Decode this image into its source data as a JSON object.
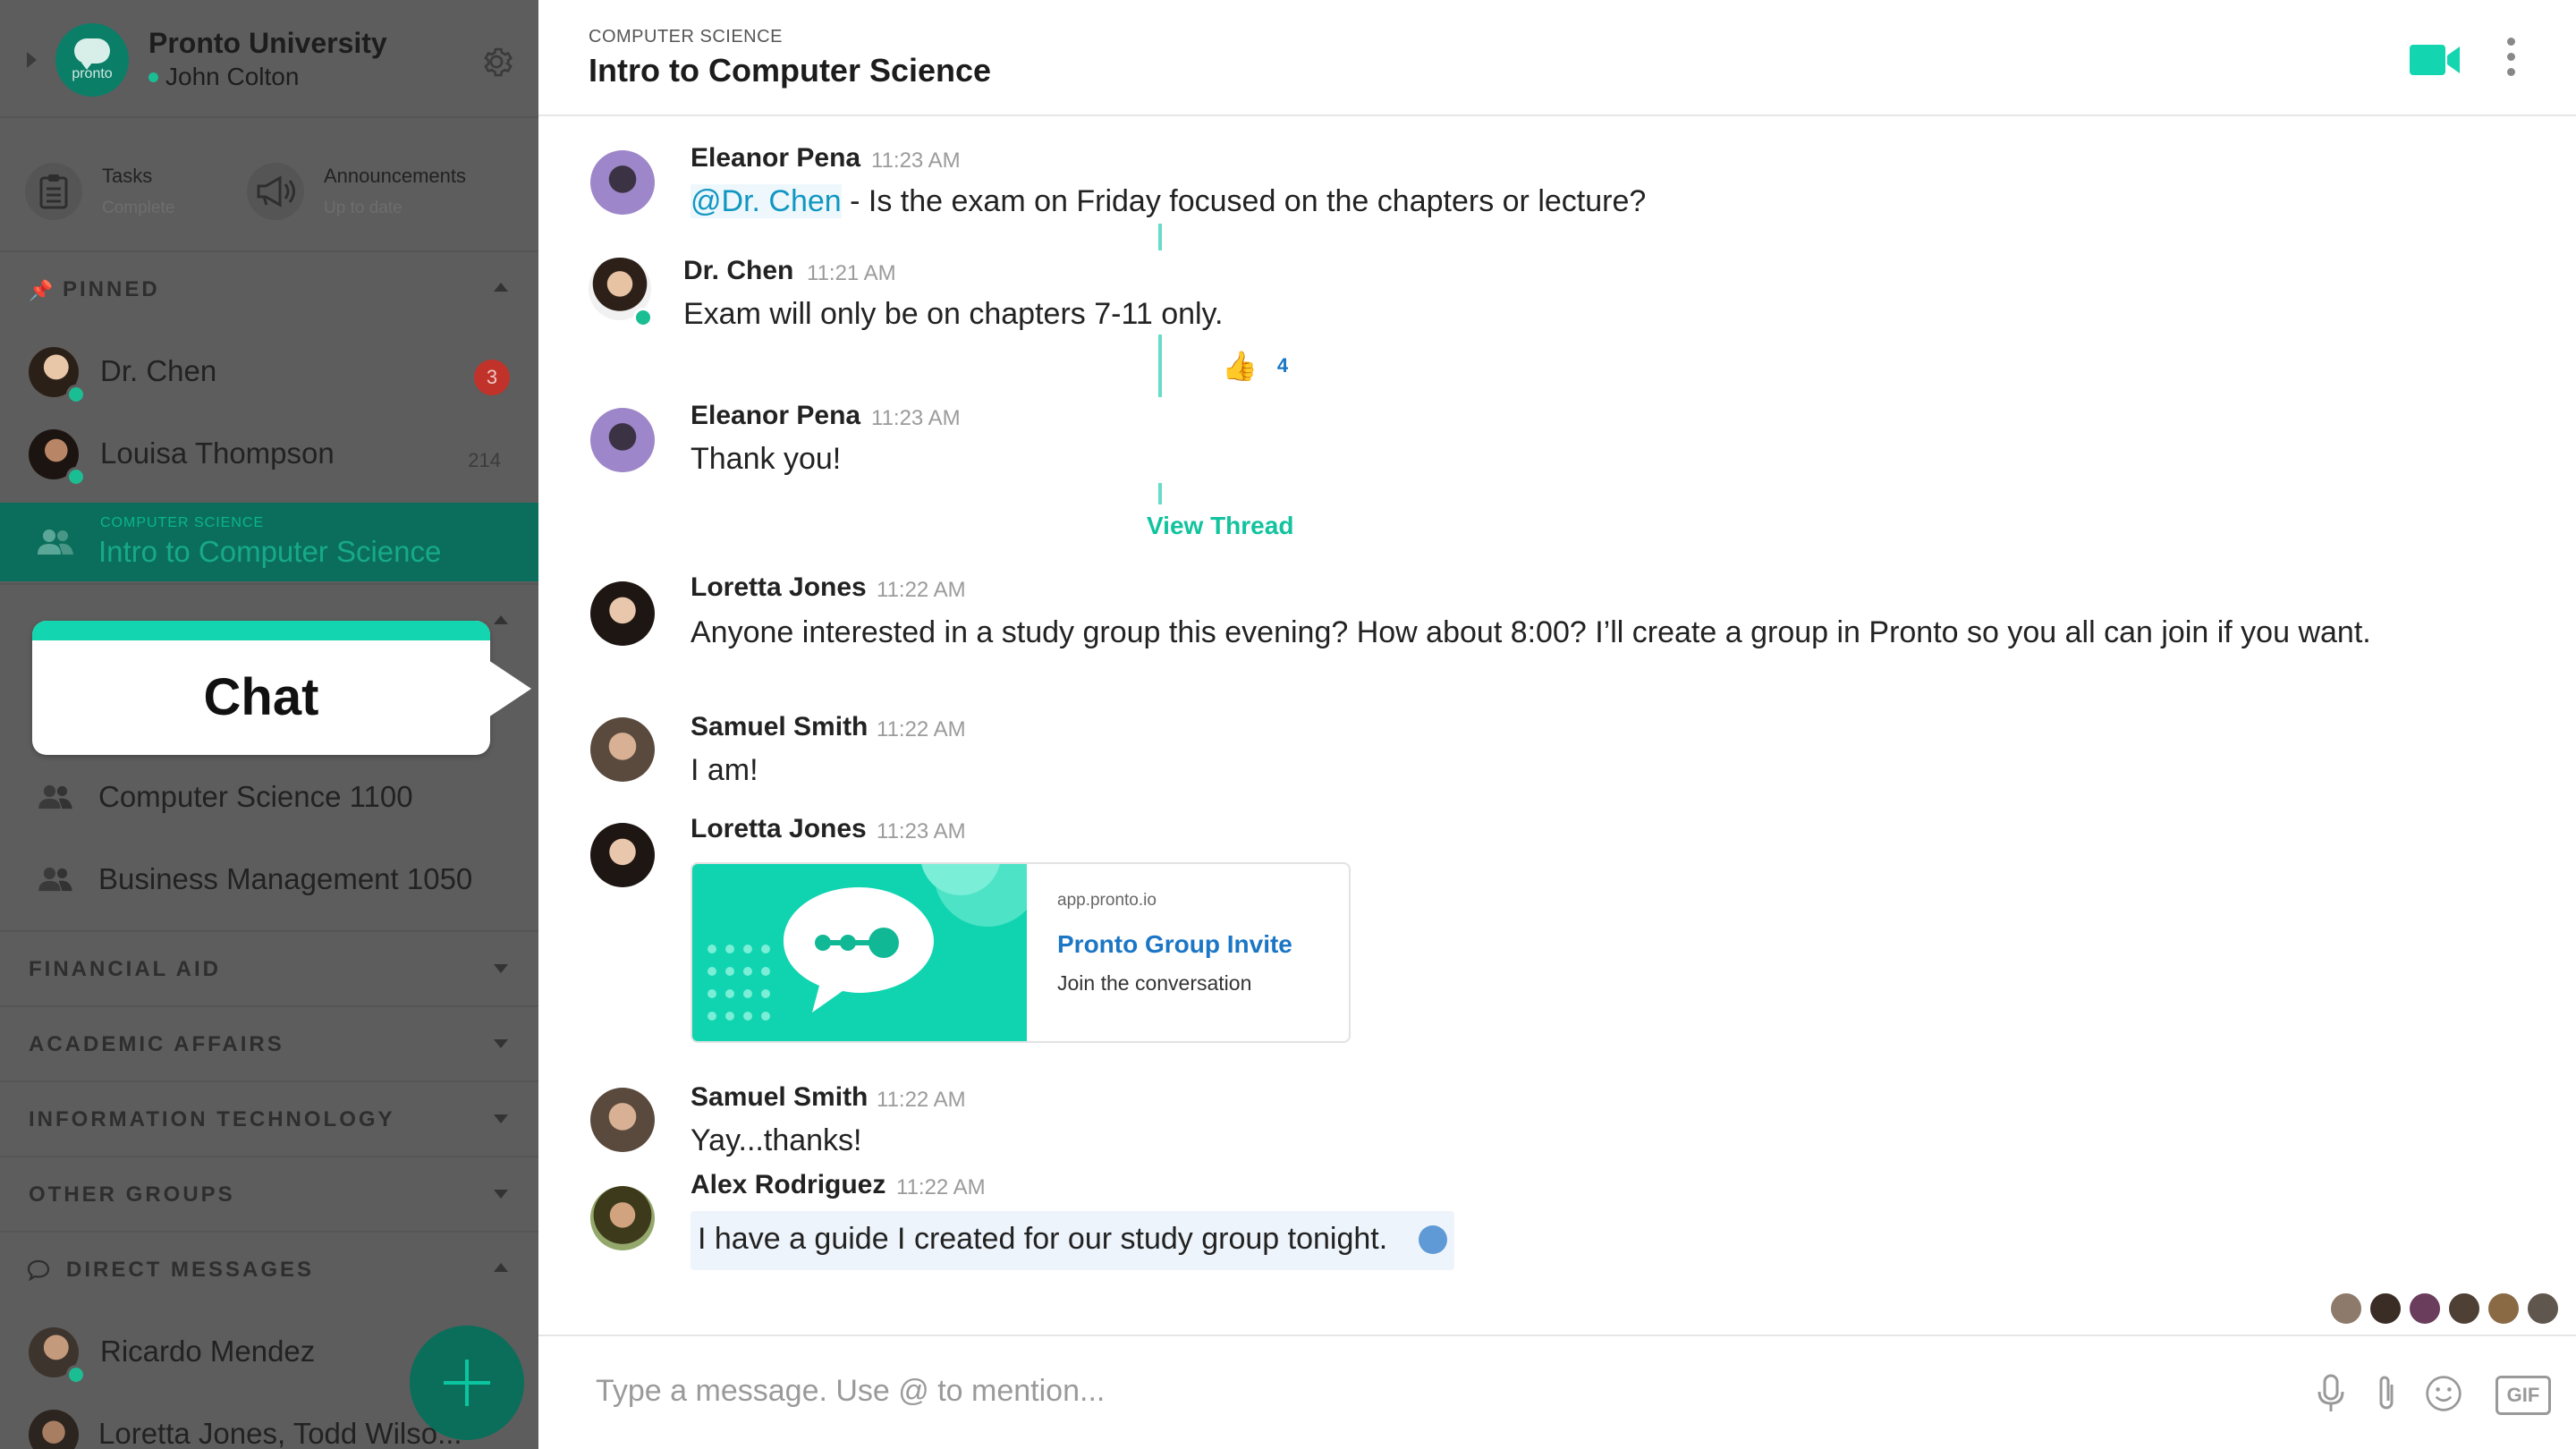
{
  "sidebar": {
    "org_name": "Pronto University",
    "logo_word": "pronto",
    "user_name": "John Colton",
    "tiles": [
      {
        "title": "Tasks",
        "status": "Complete"
      },
      {
        "title": "Announcements",
        "status": "Up to date"
      }
    ],
    "pinned_label": "PINNED",
    "pinned": [
      {
        "name": "Dr. Chen",
        "badge": "3"
      },
      {
        "name": "Louisa Thompson",
        "count": "214"
      }
    ],
    "active_channel": {
      "category": "COMPUTER SCIENCE",
      "title": "Intro to Computer Science"
    },
    "tooltip": "Chat",
    "groups": [
      {
        "name": "Computer Science 1100"
      },
      {
        "name": "Business Management 1050"
      }
    ],
    "sections": [
      "FINANCIAL AID",
      "ACADEMIC AFFAIRS",
      "INFORMATION TECHNOLOGY",
      "OTHER GROUPS"
    ],
    "dm_label": "DIRECT MESSAGES",
    "dms": [
      {
        "name": "Ricardo Mendez"
      },
      {
        "name": "Loretta Jones, Todd Wilso..."
      }
    ]
  },
  "channel": {
    "category": "COMPUTER SCIENCE",
    "title": "Intro to Computer Science"
  },
  "messages": [
    {
      "sender": "Eleanor Pena",
      "time": "11:23 AM",
      "mention": "@Dr. Chen",
      "text": " - Is the exam on Friday focused on the chapters or lecture?"
    },
    {
      "sender": "Dr. Chen",
      "time": "11:21 AM",
      "text": "Exam will only be on chapters 7-11 only.",
      "reaction": {
        "emoji": "👍",
        "count": "4"
      }
    },
    {
      "sender": "Eleanor Pena",
      "time": "11:23 AM",
      "text": "Thank you!"
    },
    {
      "sender": "Loretta Jones",
      "time": "11:22 AM",
      "text": "Anyone interested in a study group this evening? How about 8:00? I’ll create a group in Pronto so you all can join if you want."
    },
    {
      "sender": "Samuel Smith",
      "time": "11:22 AM",
      "text": "I am!"
    },
    {
      "sender": "Loretta Jones",
      "time": "11:23 AM",
      "link": {
        "domain": "app.pronto.io",
        "title": "Pronto Group Invite",
        "description": "Join the conversation"
      }
    },
    {
      "sender": "Samuel Smith",
      "time": "11:22 AM",
      "text": "Yay...thanks!"
    },
    {
      "sender": "Alex Rodriguez",
      "time": "11:22 AM",
      "text": "I have a guide I created for our study group tonight."
    }
  ],
  "view_thread": "View Thread",
  "composer": {
    "placeholder": "Type a message. Use @ to mention...",
    "gif_label": "GIF"
  },
  "colors": {
    "accent": "#13d6b0",
    "sidebar_bg": "#5d5d5d",
    "active_bg": "#0b6e5c",
    "mention": "#1196c2",
    "badge": "#c0322a"
  },
  "icons": [
    "gear-icon",
    "tasks-icon",
    "megaphone-icon",
    "pin-icon",
    "group-icon",
    "chat-bubble-icon",
    "video-icon",
    "more-vertical-icon",
    "microphone-icon",
    "paperclip-icon",
    "emoji-icon",
    "gif-icon",
    "globe-icon",
    "plus-icon"
  ]
}
